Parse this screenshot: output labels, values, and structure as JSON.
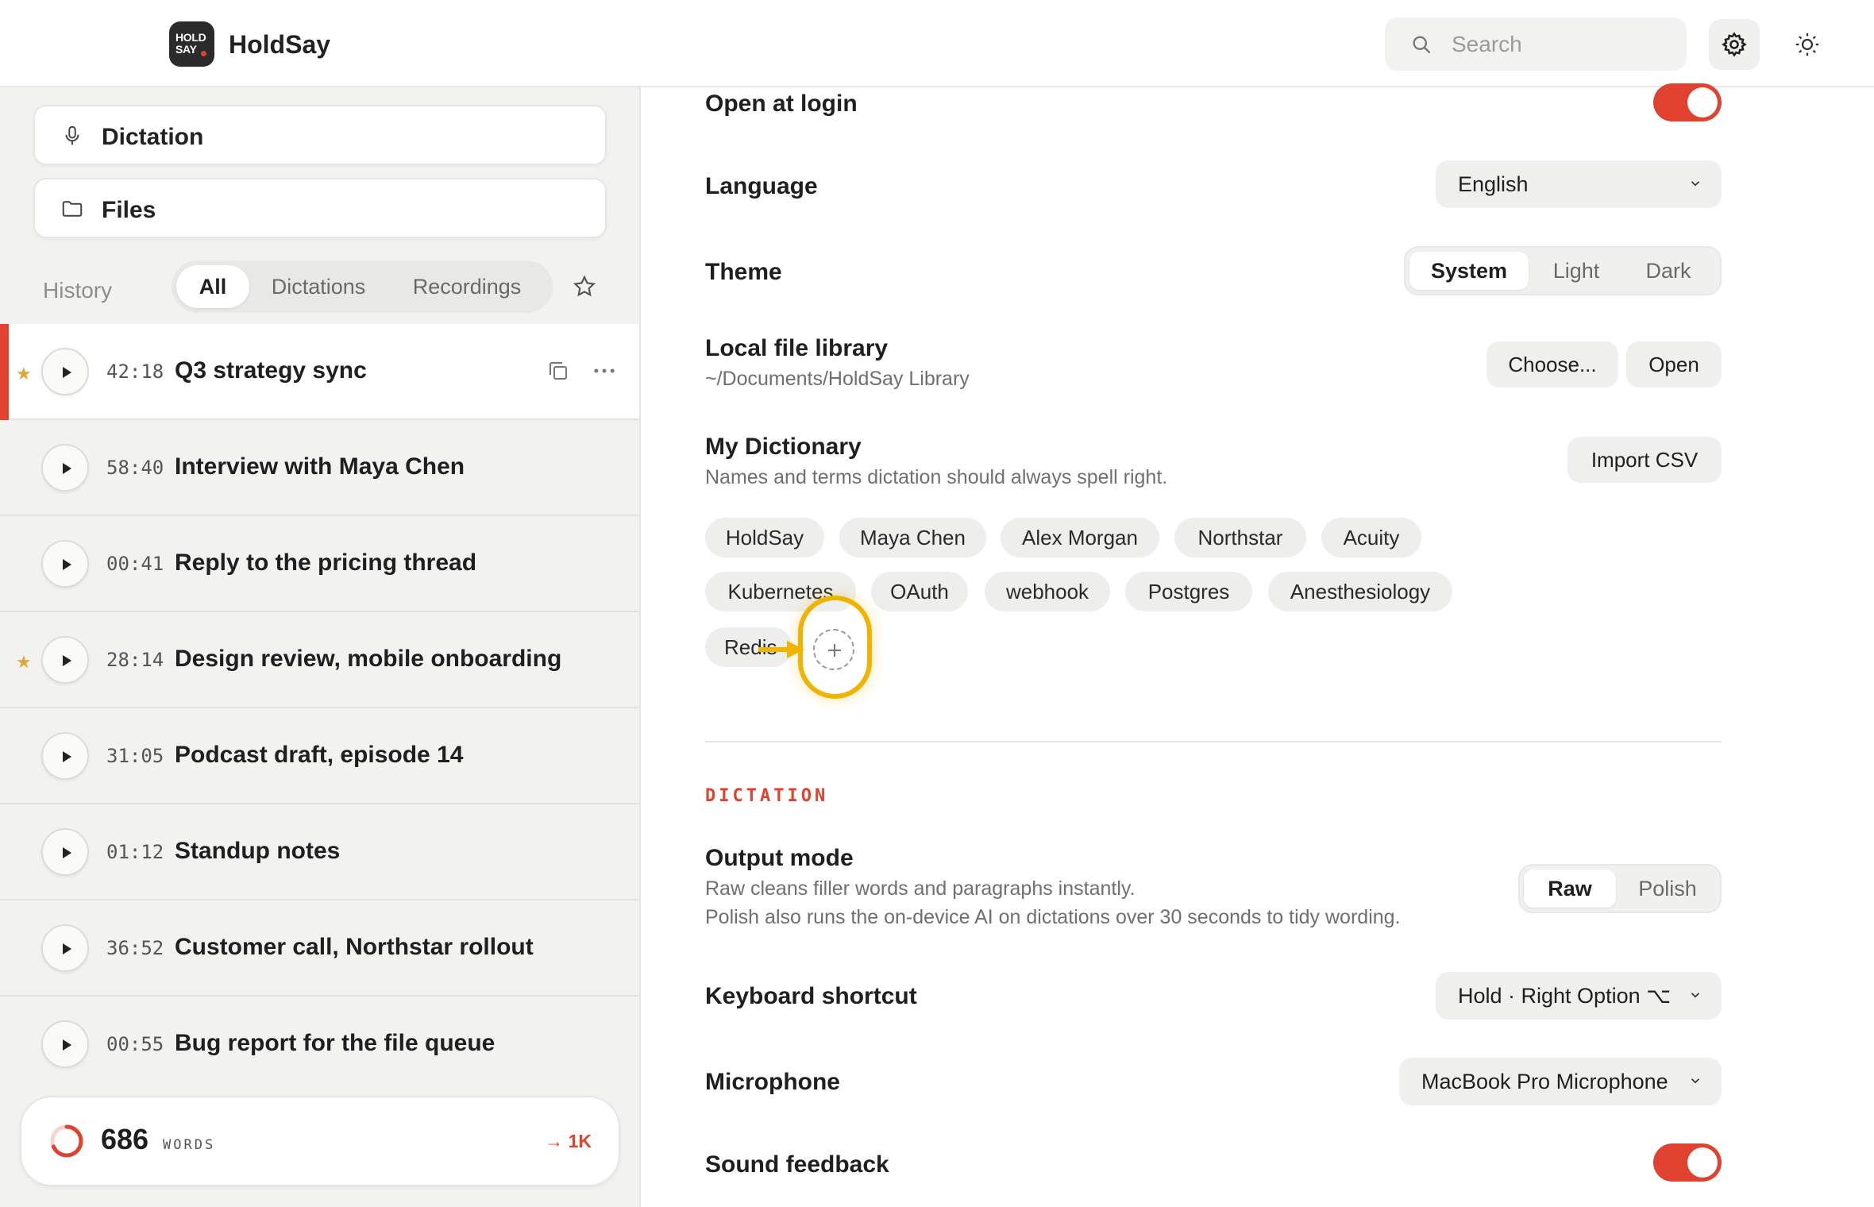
{
  "app": {
    "title": "HoldSay",
    "logo_line1": "HOLD",
    "logo_line2": "SAY"
  },
  "search": {
    "placeholder": "Search"
  },
  "sidebar": {
    "nav": [
      {
        "label": "Dictation",
        "icon": "microphone-icon"
      },
      {
        "label": "Files",
        "icon": "folder-icon"
      }
    ],
    "history_label": "History",
    "filters": [
      "All",
      "Dictations",
      "Recordings"
    ],
    "active_filter": "All",
    "items": [
      {
        "time": "42:18",
        "title": "Q3 strategy sync",
        "starred": true,
        "active": true
      },
      {
        "time": "58:40",
        "title": "Interview with Maya Chen",
        "starred": false
      },
      {
        "time": "00:41",
        "title": "Reply to the pricing thread",
        "starred": false
      },
      {
        "time": "28:14",
        "title": "Design review, mobile onboarding",
        "starred": true
      },
      {
        "time": "31:05",
        "title": "Podcast draft, episode 14",
        "starred": false
      },
      {
        "time": "01:12",
        "title": "Standup notes",
        "starred": false
      },
      {
        "time": "36:52",
        "title": "Customer call, Northstar rollout",
        "starred": false
      },
      {
        "time": "00:55",
        "title": "Bug report for the file queue",
        "starred": false
      }
    ],
    "words": {
      "count": "686",
      "unit": "WORDS",
      "goal": "→ 1K",
      "progress": 0.686
    }
  },
  "settings": {
    "open_at_login": {
      "label": "Open at login",
      "on": true
    },
    "language": {
      "label": "Language",
      "value": "English"
    },
    "theme": {
      "label": "Theme",
      "options": [
        "System",
        "Light",
        "Dark"
      ],
      "active": "System"
    },
    "library": {
      "label": "Local file library",
      "path": "~/Documents/HoldSay Library",
      "choose": "Choose...",
      "open": "Open"
    },
    "dictionary": {
      "label": "My Dictionary",
      "sub": "Names and terms dictation should always spell right.",
      "import": "Import CSV",
      "terms": [
        "HoldSay",
        "Maya Chen",
        "Alex Morgan",
        "Northstar",
        "Acuity",
        "Kubernetes",
        "OAuth",
        "webhook",
        "Postgres",
        "Anesthesiology",
        "Redis"
      ]
    },
    "section_dictation": "DICTATION",
    "output_mode": {
      "label": "Output mode",
      "sub1": "Raw cleans filler words and paragraphs instantly.",
      "sub2": "Polish also runs the on-device AI on dictations over 30 seconds to tidy wording.",
      "options": [
        "Raw",
        "Polish"
      ],
      "active": "Raw"
    },
    "shortcut": {
      "label": "Keyboard shortcut",
      "value": "Hold · Right Option ⌥"
    },
    "microphone": {
      "label": "Microphone",
      "value": "MacBook Pro Microphone"
    },
    "sound": {
      "label": "Sound feedback",
      "on": true
    }
  },
  "colors": {
    "accent": "#e0422f",
    "star": "#e0a63a",
    "highlight": "#f0b400"
  }
}
